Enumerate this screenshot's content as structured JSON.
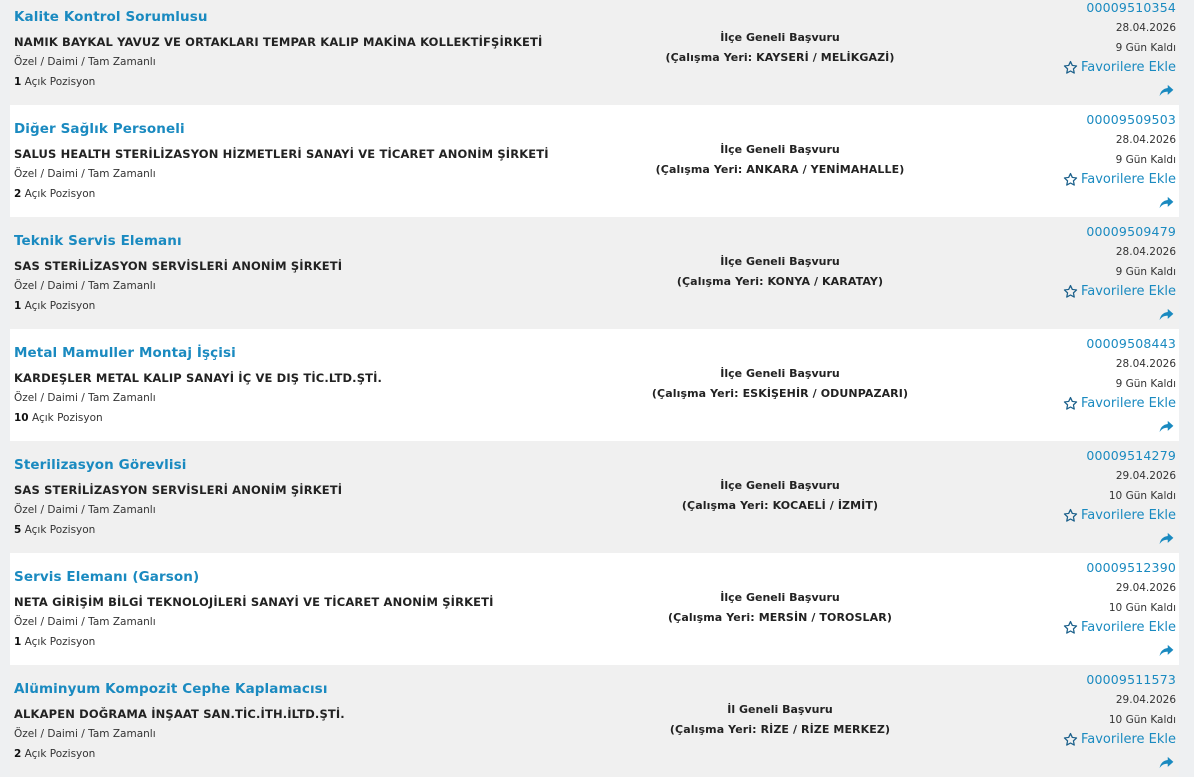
{
  "listings": [
    {
      "title": "Kalite Kontrol Sorumlusu",
      "company": "NAMIK BAYKAL YAVUZ VE ORTAKLARI TEMPAR KALIP MAKİNA KOLLEKTİFŞİRKETİ",
      "type": "Özel / Daimi / Tam Zamanlı",
      "count": "1",
      "count_label": "Açık Pozisyon",
      "scope": "İlçe Geneli Başvuru",
      "location": "(Çalışma Yeri: KAYSERİ / MELİKGAZİ)",
      "ilan_no": "00009510354",
      "date": "28.04.2026",
      "remaining": "9 Gün Kaldı",
      "fav_label": "Favorilere Ekle"
    },
    {
      "title": "Diğer Sağlık Personeli",
      "company": "SALUS HEALTH STERİLİZASYON HİZMETLERİ SANAYİ VE TİCARET ANONİM ŞİRKETİ",
      "type": "Özel / Daimi / Tam Zamanlı",
      "count": "2",
      "count_label": "Açık Pozisyon",
      "scope": "İlçe Geneli Başvuru",
      "location": "(Çalışma Yeri: ANKARA / YENİMAHALLE)",
      "ilan_no": "00009509503",
      "date": "28.04.2026",
      "remaining": "9 Gün Kaldı",
      "fav_label": "Favorilere Ekle"
    },
    {
      "title": "Teknik Servis Elemanı",
      "company": "SAS STERİLİZASYON SERVİSLERİ ANONİM ŞİRKETİ",
      "type": "Özel / Daimi / Tam Zamanlı",
      "count": "1",
      "count_label": "Açık Pozisyon",
      "scope": "İlçe Geneli Başvuru",
      "location": "(Çalışma Yeri: KONYA / KARATAY)",
      "ilan_no": "00009509479",
      "date": "28.04.2026",
      "remaining": "9 Gün Kaldı",
      "fav_label": "Favorilere Ekle"
    },
    {
      "title": "Metal Mamuller Montaj İşçisi",
      "company": "KARDEŞLER METAL KALIP SANAYİ İÇ VE DIŞ TİC.LTD.ŞTİ.",
      "type": "Özel / Daimi / Tam Zamanlı",
      "count": "10",
      "count_label": "Açık Pozisyon",
      "scope": "İlçe Geneli Başvuru",
      "location": "(Çalışma Yeri: ESKİŞEHİR / ODUNPAZARI)",
      "ilan_no": "00009508443",
      "date": "28.04.2026",
      "remaining": "9 Gün Kaldı",
      "fav_label": "Favorilere Ekle"
    },
    {
      "title": "Sterilizasyon Görevlisi",
      "company": "SAS STERİLİZASYON SERVİSLERİ ANONİM ŞİRKETİ",
      "type": "Özel / Daimi / Tam Zamanlı",
      "count": "5",
      "count_label": "Açık Pozisyon",
      "scope": "İlçe Geneli Başvuru",
      "location": "(Çalışma Yeri: KOCAELİ / İZMİT)",
      "ilan_no": "00009514279",
      "date": "29.04.2026",
      "remaining": "10 Gün Kaldı",
      "fav_label": "Favorilere Ekle"
    },
    {
      "title": "Servis Elemanı (Garson)",
      "company": "NETA GİRİŞİM BİLGİ TEKNOLOJİLERİ SANAYİ VE TİCARET ANONİM ŞİRKETİ",
      "type": "Özel / Daimi / Tam Zamanlı",
      "count": "1",
      "count_label": "Açık Pozisyon",
      "scope": "İlçe Geneli Başvuru",
      "location": "(Çalışma Yeri: MERSİN / TOROSLAR)",
      "ilan_no": "00009512390",
      "date": "29.04.2026",
      "remaining": "10 Gün Kaldı",
      "fav_label": "Favorilere Ekle"
    },
    {
      "title": "Alüminyum Kompozit Cephe Kaplamacısı",
      "company": "ALKAPEN DOĞRAMA İNŞAAT SAN.TİC.İTH.İLTD.ŞTİ.",
      "type": "Özel / Daimi / Tam Zamanlı",
      "count": "2",
      "count_label": "Açık Pozisyon",
      "scope": "İl Geneli Başvuru",
      "location": "(Çalışma Yeri: RİZE / RİZE MERKEZ)",
      "ilan_no": "00009511573",
      "date": "29.04.2026",
      "remaining": "10 Gün Kaldı",
      "fav_label": "Favorilere Ekle"
    }
  ],
  "icons": {
    "favorite": "star-outline-icon",
    "share": "share-arrow-icon"
  },
  "colors": {
    "link": "#1a8ac0",
    "row_alt": "#f0f0f0",
    "row_plain": "#ffffff"
  }
}
